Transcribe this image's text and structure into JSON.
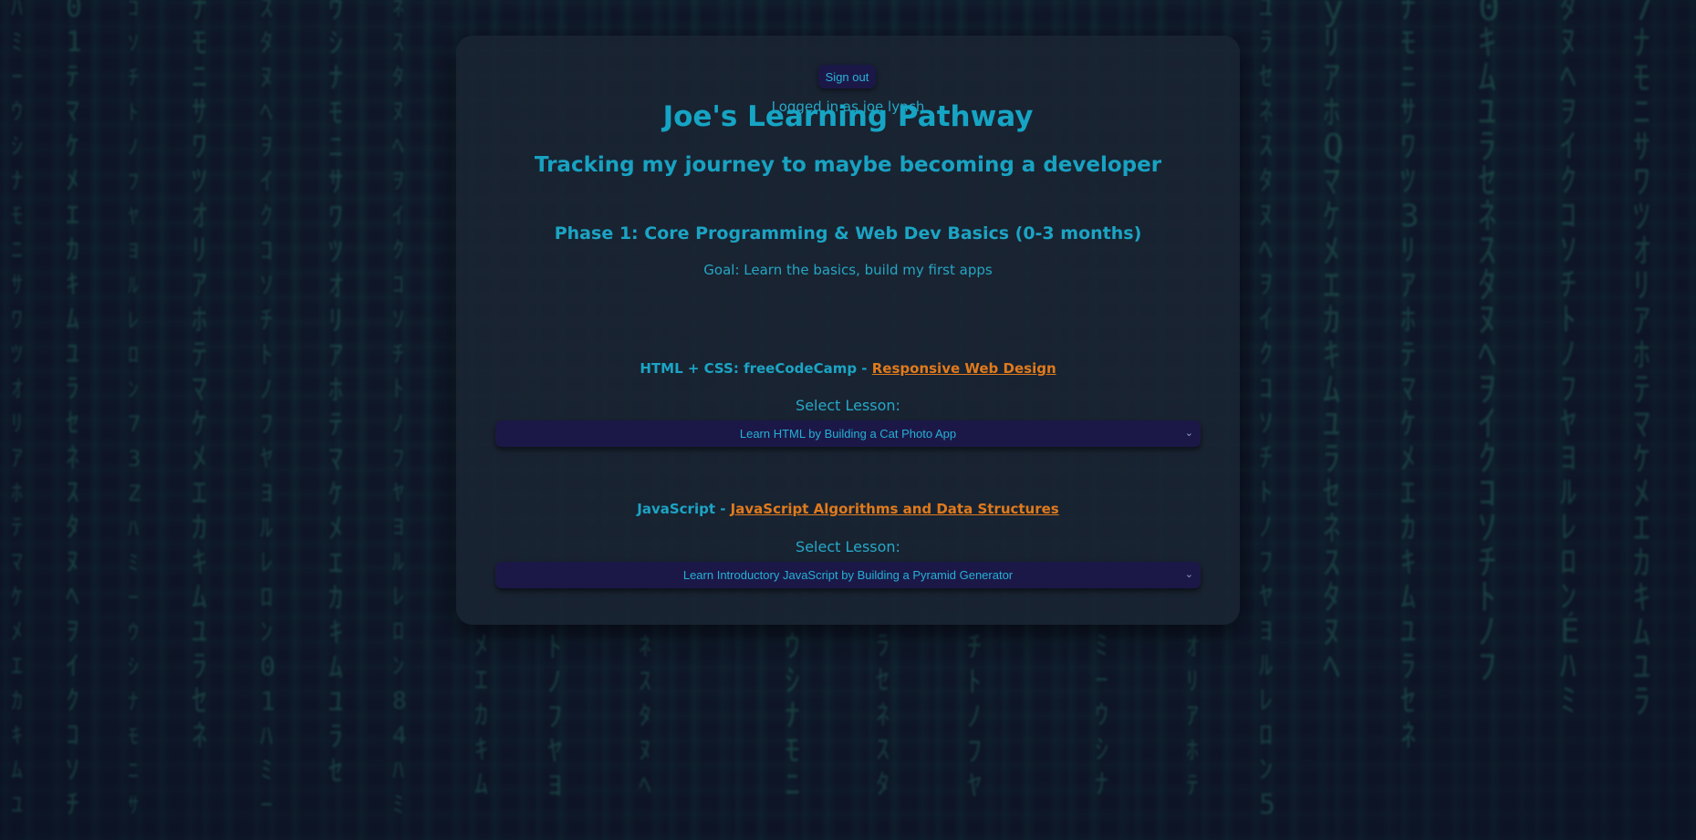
{
  "header": {
    "signout_label": "Sign out",
    "logged_in_text": "Logged in as joe lynch"
  },
  "page": {
    "title": "Joe's Learning Pathway",
    "subtitle": "Tracking my journey to maybe becoming a developer"
  },
  "phase": {
    "title": "Phase 1: Core Programming & Web Dev Basics (0-3 months)",
    "goal": "Goal: Learn the basics, build my first apps"
  },
  "courses": [
    {
      "prefix": "HTML + CSS: freeCodeCamp - ",
      "link_text": "Responsive Web Design",
      "select_label": "Select Lesson:",
      "selected_lesson": "Learn HTML by Building a Cat Photo App"
    },
    {
      "prefix": "JavaScript - ",
      "link_text": "JavaScript Algorithms and Data Structures",
      "select_label": "Select Lesson:",
      "selected_lesson": "Learn Introductory JavaScript by Building a Pyramid Generator"
    }
  ],
  "colors": {
    "accent_teal": "#1ca4c4",
    "link_orange": "#e07a1c",
    "button_bg": "#1b1848",
    "card_bg": "#1a2432"
  },
  "icons": {
    "dropdown": "chevron-down-icon"
  }
}
